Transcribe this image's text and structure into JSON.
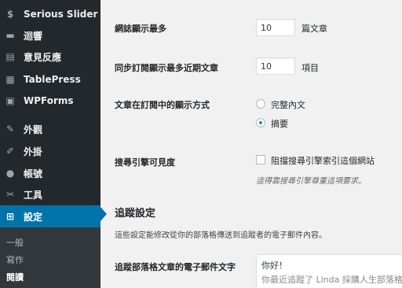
{
  "sidebar": {
    "items": [
      {
        "label": "Serious Slider",
        "icon": "$"
      },
      {
        "label": "迴響",
        "icon": "▬"
      },
      {
        "label": "意見反應",
        "icon": "▤"
      },
      {
        "label": "TablePress",
        "icon": "▦"
      },
      {
        "label": "WPForms",
        "icon": "▣"
      },
      {
        "label": "外觀",
        "icon": "✎"
      },
      {
        "label": "外掛",
        "icon": "✐"
      },
      {
        "label": "帳號",
        "icon": "●"
      },
      {
        "label": "工具",
        "icon": "✂"
      },
      {
        "label": "設定",
        "icon": "⊞"
      }
    ],
    "submenu": [
      "一般",
      "寫作",
      "閱讀"
    ]
  },
  "settings": {
    "posts_per_page": {
      "label": "網誌顯示最多",
      "value": "10",
      "unit": "篇文章"
    },
    "posts_per_rss": {
      "label": "同步訂閱顯示最多近期文章",
      "value": "10",
      "unit": "項目"
    },
    "rss_use_excerpt": {
      "label": "文章在訂閱中的顯示方式",
      "options": [
        "完整內文",
        "摘要"
      ],
      "selected": "摘要"
    },
    "search_visibility": {
      "label": "搜尋引擎可見度",
      "checkbox_label": "阻擋搜尋引擎索引這個網站",
      "description": "這得靠搜尋引擎尊重這項要求。"
    }
  },
  "tracking": {
    "title": "追蹤設定",
    "description": "這些設定能修改從你的部落格傳送到追蹤者的電子郵件內容。",
    "email_label": "追蹤部落格文章的電子郵件文字",
    "email_line1": "你好！",
    "email_line2": "你最近追蹤了 Linda 採購人生部落格的"
  }
}
